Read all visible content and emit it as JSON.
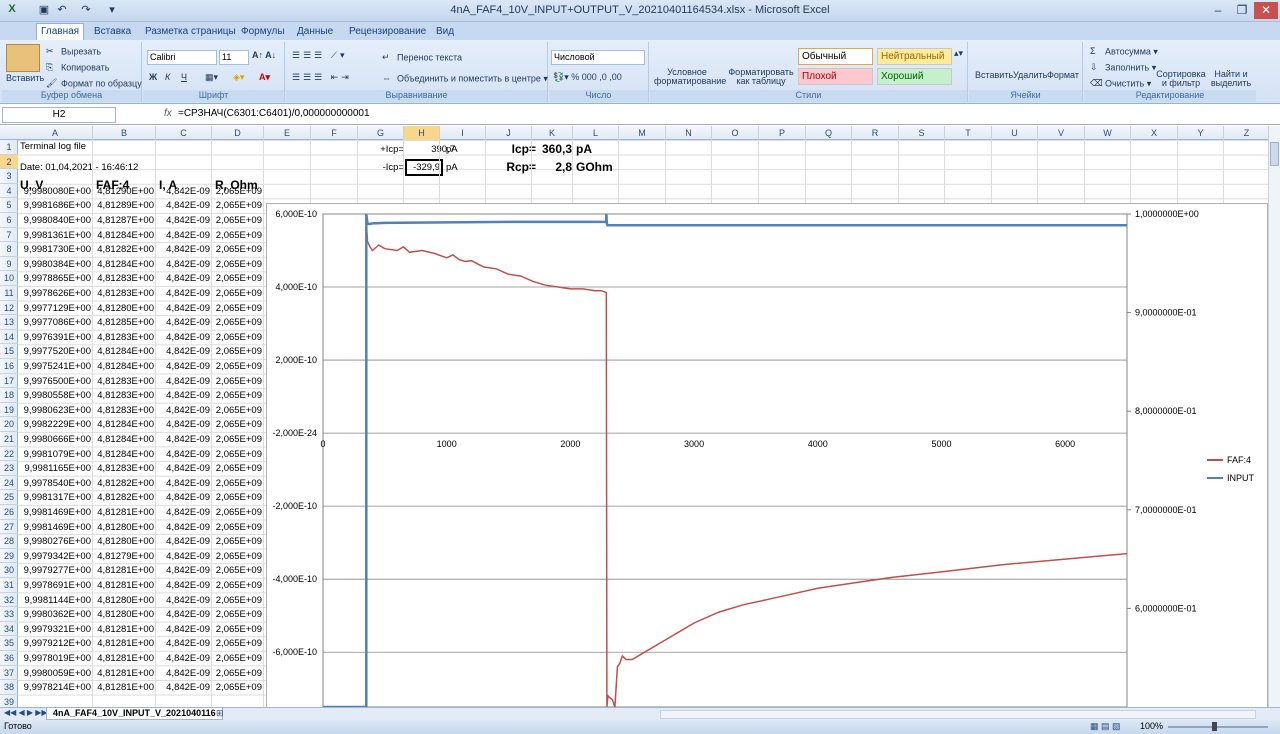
{
  "window": {
    "title": "4nA_FAF4_10V_INPUT+OUTPUT_V_20210401164534.xlsx - Microsoft Excel"
  },
  "tabs": [
    "Главная",
    "Вставка",
    "Разметка страницы",
    "Формулы",
    "Данные",
    "Рецензирование",
    "Вид"
  ],
  "ribbon": {
    "clipboard": {
      "paste": "Вставить",
      "cut": "Вырезать",
      "copy": "Копировать",
      "format_painter": "Формат по образцу",
      "label": "Буфер обмена"
    },
    "font": {
      "name": "Calibri",
      "size": "11",
      "label": "Шрифт",
      "bold": "Ж",
      "italic": "К",
      "underline": "Ч"
    },
    "alignment": {
      "wrap": "Перенос текста",
      "merge": "Объединить и поместить в центре",
      "label": "Выравнивание"
    },
    "number": {
      "format": "Числовой",
      "label": "Число"
    },
    "styles": {
      "cond": "Условное форматирование",
      "table": "Форматировать как таблицу",
      "normal": "Обычный",
      "neutral": "Нейтральный",
      "bad": "Плохой",
      "good": "Хороший",
      "label": "Стили"
    },
    "cells": {
      "insert": "Вставить",
      "delete": "Удалить",
      "format": "Формат",
      "label": "Ячейки"
    },
    "editing": {
      "autosum": "Автосумма",
      "fill": "Заполнить",
      "clear": "Очистить",
      "sort": "Сортировка и фильтр",
      "find": "Найти и выделить",
      "label": "Редактирование"
    }
  },
  "formula_bar": {
    "name_box": "H2",
    "fx": "fx",
    "formula": "=СРЗНАЧ(C6301:C6401)/0,000000000001"
  },
  "columns": [
    "A",
    "B",
    "C",
    "D",
    "E",
    "F",
    "G",
    "H",
    "I",
    "J",
    "K",
    "L",
    "M",
    "N",
    "O",
    "P",
    "Q",
    "R",
    "S",
    "T",
    "U",
    "V",
    "W",
    "X",
    "Y",
    "Z"
  ],
  "sheet": {
    "a1": "Terminal log file",
    "a2": "Date: 01,04,2021 - 16:46:12",
    "headers": [
      "U, V",
      "FAF:4",
      "I, A",
      "R, Ohm"
    ],
    "g1": "+Icp=",
    "h1": "390,7",
    "i1": "pA",
    "g2": "-Icp=",
    "h2": "-329,9",
    "i2": "pA",
    "j1": "Icp=",
    "k1": "360,3",
    "l1": "pA",
    "j2": "Rcp=",
    "k2": "2,8",
    "l2": "GOhm",
    "rows": [
      [
        "9,9980080E+00",
        "4,81290E+00",
        "4,842E-09",
        "2,065E+09"
      ],
      [
        "9,9981686E+00",
        "4,81289E+00",
        "4,842E-09",
        "2,065E+09"
      ],
      [
        "9,9980840E+00",
        "4,81287E+00",
        "4,842E-09",
        "2,065E+09"
      ],
      [
        "9,9981361E+00",
        "4,81284E+00",
        "4,842E-09",
        "2,065E+09"
      ],
      [
        "9,9981730E+00",
        "4,81282E+00",
        "4,842E-09",
        "2,065E+09"
      ],
      [
        "9,9980384E+00",
        "4,81284E+00",
        "4,842E-09",
        "2,065E+09"
      ],
      [
        "9,9978865E+00",
        "4,81283E+00",
        "4,842E-09",
        "2,065E+09"
      ],
      [
        "9,9978626E+00",
        "4,81283E+00",
        "4,842E-09",
        "2,065E+09"
      ],
      [
        "9,9977129E+00",
        "4,81280E+00",
        "4,842E-09",
        "2,065E+09"
      ],
      [
        "9,9977086E+00",
        "4,81285E+00",
        "4,842E-09",
        "2,065E+09"
      ],
      [
        "9,9976391E+00",
        "4,81283E+00",
        "4,842E-09",
        "2,065E+09"
      ],
      [
        "9,9977520E+00",
        "4,81284E+00",
        "4,842E-09",
        "2,065E+09"
      ],
      [
        "9,9975241E+00",
        "4,81284E+00",
        "4,842E-09",
        "2,065E+09"
      ],
      [
        "9,9976500E+00",
        "4,81283E+00",
        "4,842E-09",
        "2,065E+09"
      ],
      [
        "9,9980558E+00",
        "4,81283E+00",
        "4,842E-09",
        "2,065E+09"
      ],
      [
        "9,9980623E+00",
        "4,81283E+00",
        "4,842E-09",
        "2,065E+09"
      ],
      [
        "9,9982229E+00",
        "4,81284E+00",
        "4,842E-09",
        "2,065E+09"
      ],
      [
        "9,9980666E+00",
        "4,81284E+00",
        "4,842E-09",
        "2,065E+09"
      ],
      [
        "9,9981079E+00",
        "4,81284E+00",
        "4,842E-09",
        "2,065E+09"
      ],
      [
        "9,9981165E+00",
        "4,81283E+00",
        "4,842E-09",
        "2,065E+09"
      ],
      [
        "9,9978540E+00",
        "4,81282E+00",
        "4,842E-09",
        "2,065E+09"
      ],
      [
        "9,9981317E+00",
        "4,81282E+00",
        "4,842E-09",
        "2,065E+09"
      ],
      [
        "9,9981469E+00",
        "4,81281E+00",
        "4,842E-09",
        "2,065E+09"
      ],
      [
        "9,9981469E+00",
        "4,81280E+00",
        "4,842E-09",
        "2,065E+09"
      ],
      [
        "9,9980276E+00",
        "4,81280E+00",
        "4,842E-09",
        "2,065E+09"
      ],
      [
        "9,9979342E+00",
        "4,81279E+00",
        "4,842E-09",
        "2,065E+09"
      ],
      [
        "9,9979277E+00",
        "4,81281E+00",
        "4,842E-09",
        "2,065E+09"
      ],
      [
        "9,9978691E+00",
        "4,81281E+00",
        "4,842E-09",
        "2,065E+09"
      ],
      [
        "9,9981144E+00",
        "4,81280E+00",
        "4,842E-09",
        "2,065E+09"
      ],
      [
        "9,9980362E+00",
        "4,81280E+00",
        "4,842E-09",
        "2,065E+09"
      ],
      [
        "9,9979321E+00",
        "4,81281E+00",
        "4,842E-09",
        "2,065E+09"
      ],
      [
        "9,9979212E+00",
        "4,81281E+00",
        "4,842E-09",
        "2,065E+09"
      ],
      [
        "9,9978019E+00",
        "4,81281E+00",
        "4,842E-09",
        "2,065E+09"
      ],
      [
        "9,9980059E+00",
        "4,81281E+00",
        "4,842E-09",
        "2,065E+09"
      ],
      [
        "9,9978214E+00",
        "4,81281E+00",
        "4,842E-09",
        "2,065E+09"
      ]
    ]
  },
  "chart_data": {
    "type": "line",
    "xlim": [
      0,
      6500
    ],
    "ylim_left": [
      -7.5e-10,
      6e-10
    ],
    "ylim_right": [
      0.5,
      1.0
    ],
    "x_ticks": [
      "0",
      "1000",
      "2000",
      "3000",
      "4000",
      "5000",
      "6000"
    ],
    "y_left_ticks": [
      "6,000E-10",
      "4,000E-10",
      "2,000E-10",
      "-2,000E-24",
      "-2,000E-10",
      "-4,000E-10",
      "-6,000E-10"
    ],
    "y_right_ticks": [
      "1,0000000E+00",
      "9,0000000E-01",
      "8,0000000E-01",
      "7,0000000E-01",
      "6,0000000E-01"
    ],
    "legend_position": "right",
    "series": [
      {
        "name": "FAF:4",
        "color": "#c0504d",
        "axis": "left",
        "x": [
          350,
          360,
          380,
          400,
          450,
          500,
          600,
          650,
          700,
          800,
          900,
          1000,
          1050,
          1100,
          1150,
          1200,
          1300,
          1400,
          1500,
          1600,
          1700,
          1800,
          1900,
          2000,
          2100,
          2200,
          2250,
          2290,
          2295,
          2300,
          2305,
          2320,
          2340,
          2360,
          2380,
          2400,
          2420,
          2450,
          2500,
          2600,
          2700,
          2800,
          2900,
          3000,
          3200,
          3400,
          3600,
          3800,
          4000,
          4300,
          4600,
          5000,
          5500,
          6000,
          6500
        ],
        "y": [
          5.8e-10,
          5.25e-10,
          5.1e-10,
          5e-10,
          5.15e-10,
          5.05e-10,
          5e-10,
          5.1e-10,
          4.95e-10,
          5e-10,
          4.92e-10,
          4.8e-10,
          4.88e-10,
          4.75e-10,
          4.7e-10,
          4.72e-10,
          4.55e-10,
          4.5e-10,
          4.35e-10,
          4.3e-10,
          4.15e-10,
          4.05e-10,
          4e-10,
          3.95e-10,
          3.95e-10,
          3.9e-10,
          3.9e-10,
          3.85e-10,
          -7.5e-10,
          -7.3e-10,
          -7.2e-10,
          -7.25e-10,
          -7.3e-10,
          -7.5e-10,
          -6.4e-10,
          -6.3e-10,
          -6.1e-10,
          -6.2e-10,
          -6.2e-10,
          -6e-10,
          -5.8e-10,
          -5.6e-10,
          -5.4e-10,
          -5.2e-10,
          -4.9e-10,
          -4.7e-10,
          -4.55e-10,
          -4.4e-10,
          -4.25e-10,
          -4.1e-10,
          -3.95e-10,
          -3.8e-10,
          -3.6e-10,
          -3.45e-10,
          -3.3e-10
        ]
      },
      {
        "name": "INPUT",
        "color": "#4f81bd",
        "axis": "right",
        "x": [
          0,
          300,
          350,
          350,
          360,
          380,
          400,
          500,
          1000,
          1500,
          2000,
          2200,
          2290,
          2290,
          2295,
          2300,
          2400,
          3000,
          4000,
          5000,
          6000,
          6500
        ],
        "y": [
          0.5,
          0.5,
          0.5,
          1.005,
          0.99,
          0.99,
          0.9905,
          0.991,
          0.9915,
          0.992,
          0.992,
          0.992,
          0.992,
          1.01,
          0.99,
          0.9885,
          0.9885,
          0.9885,
          0.9885,
          0.9885,
          0.9885,
          0.9885
        ]
      }
    ]
  },
  "sheet_tab": "4nA_FAF4_10V_INPUT_V_2021040116",
  "status": {
    "ready": "Готово",
    "zoom": "100%"
  }
}
